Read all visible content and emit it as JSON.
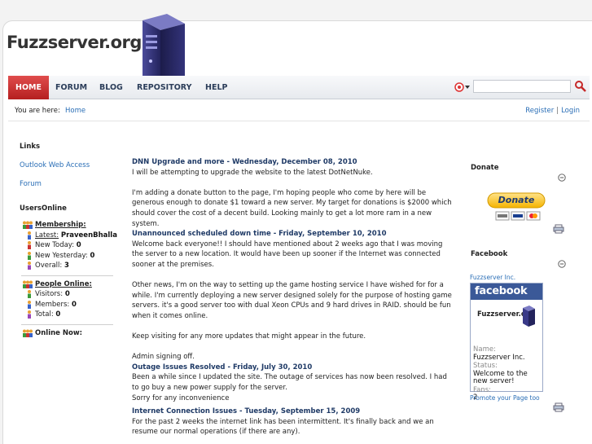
{
  "site": {
    "logo_text": "Fuzzserver.org"
  },
  "nav": {
    "items": [
      "HOME",
      "FORUM",
      "BLOG",
      "REPOSITORY",
      "HELP"
    ],
    "search_placeholder": ""
  },
  "breadcrumb": {
    "label": "You are here:",
    "home": "Home"
  },
  "user_links": {
    "register": "Register",
    "separator": "|",
    "login": "Login"
  },
  "left": {
    "links_title": "Links",
    "links": [
      "Outlook Web Access",
      "Forum"
    ],
    "users_online_title": "UsersOnline",
    "membership": {
      "title": "Membership:",
      "latest_label": "Latest:",
      "latest_value": "PraveenBhalla",
      "new_today_label": "New Today:",
      "new_today_value": "0",
      "new_yesterday_label": "New Yesterday:",
      "new_yesterday_value": "0",
      "overall_label": "Overall:",
      "overall_value": "3"
    },
    "people": {
      "title": "People Online:",
      "visitors_label": "Visitors:",
      "visitors_value": "0",
      "members_label": "Members:",
      "members_value": "0",
      "total_label": "Total:",
      "total_value": "0"
    },
    "online_now": "Online Now:"
  },
  "posts": [
    {
      "title": "DNN Upgrade and more - Wednesday, December 08, 2010",
      "paragraphs": [
        "I will be attempting to upgrade the website to the latest DotNetNuke.",
        "I'm adding a donate button to the page, I'm hoping people who come by here will be generous enough to donate $1 toward a new server. My target for donations is $2000 which should cover the cost of a decent build. Looking mainly to get a lot more ram in a new system."
      ]
    },
    {
      "title": "Unannounced scheduled down time - Friday, September 10, 2010",
      "paragraphs": [
        "Welcome back everyone!! I should have mentioned about 2 weeks ago that I was moving the server to a new location. It would have been up sooner if the Internet was connected sooner at the premises.",
        "Other news, I'm on the way to setting up the game hosting service I have wished for for a while. I'm currently deploying a new server designed solely for the purpose of hosting game servers. it's a good server too with dual Xeon CPUs and 9 hard drives in RAID. should be fun when it comes online.",
        "Keep visiting for any more updates that might appear in the future.",
        "Admin signing off."
      ]
    },
    {
      "title": "Outage Issues Resolved - Friday, July 30, 2010",
      "paragraphs": [
        "Been a while since I updated the site. The outage of services has now been resolved. I had to go buy a new power supply for the server.",
        "Sorry for any inconvenience"
      ]
    },
    {
      "title": "Internet Connection Issues - Tuesday, September 15, 2009",
      "paragraphs": [
        " For the past 2 weeks the internet link has been intermittent. It's finally back and we an resume our normal operations (if there are any)."
      ]
    }
  ],
  "right": {
    "donate_title": "Donate",
    "donate_button": "Donate",
    "facebook_title": "Facebook",
    "fb_page_link": "Fuzzserver Inc.",
    "fb_brand": "facebook",
    "fb_logo_text": "Fuzzserver.org",
    "fb_name_label": "Name:",
    "fb_name_value": "Fuzzserver Inc.",
    "fb_status_label": "Status:",
    "fb_status_value": "Welcome to the new server!",
    "fb_fans_label": "Fans:",
    "fb_fans_value": "2",
    "fb_promo": "Promote your Page too"
  },
  "colors": {
    "nav_active": "#c62828",
    "link": "#2a6eb6",
    "facebook": "#3b5998",
    "donate": "#f5b400"
  },
  "icons": [
    "server-logo-icon",
    "flag-icon",
    "search-icon",
    "group-icon",
    "user-icon",
    "collapse-icon",
    "print-icon",
    "card-icons"
  ]
}
